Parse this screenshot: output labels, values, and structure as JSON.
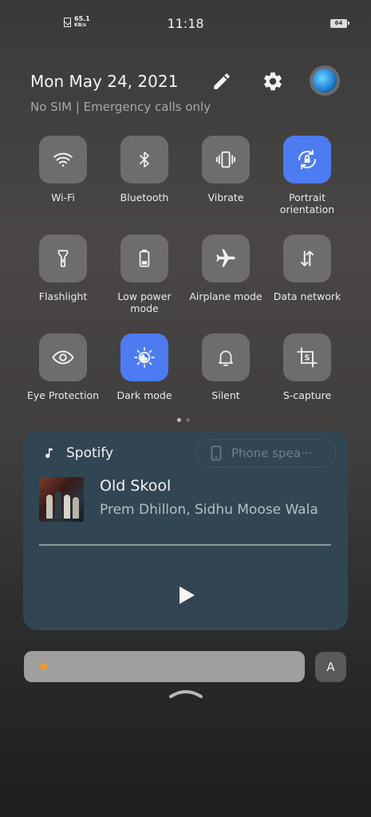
{
  "status_bar": {
    "net_speed_value": "65.1",
    "net_speed_unit": "KB/s",
    "time": "11:18",
    "battery": "64"
  },
  "header": {
    "date": "Mon May 24, 2021",
    "sim_status": "No SIM | Emergency calls only",
    "edit_icon": "pencil-icon",
    "settings_icon": "gear-icon"
  },
  "tiles": [
    {
      "label": "Wi-Fi",
      "icon": "wifi-icon",
      "active": false
    },
    {
      "label": "Bluetooth",
      "icon": "bluetooth-icon",
      "active": false
    },
    {
      "label": "Vibrate",
      "icon": "vibrate-icon",
      "active": false
    },
    {
      "label": "Portrait orientation",
      "icon": "rotation-lock-icon",
      "active": true
    },
    {
      "label": "Flashlight",
      "icon": "flashlight-icon",
      "active": false
    },
    {
      "label": "Low power mode",
      "icon": "battery-icon",
      "active": false
    },
    {
      "label": "Airplane mode",
      "icon": "airplane-icon",
      "active": false
    },
    {
      "label": "Data network",
      "icon": "data-arrows-icon",
      "active": false
    },
    {
      "label": "Eye Protection",
      "icon": "eye-icon",
      "active": false
    },
    {
      "label": "Dark mode",
      "icon": "dark-mode-icon",
      "active": true
    },
    {
      "label": "Silent",
      "icon": "bell-icon",
      "active": false
    },
    {
      "label": "S-capture",
      "icon": "screenshot-icon",
      "active": false
    }
  ],
  "media": {
    "app_name": "Spotify",
    "output_device": "Phone spea···",
    "title": "Old Skool",
    "artist": "Prem Dhillon, Sidhu Moose Wala",
    "progress": 0
  },
  "brightness": {
    "auto_label": "A"
  },
  "colors": {
    "active_tile": "#4d7cf2",
    "inactive_tile": "#6e6c6c",
    "media_card": "#324553",
    "brightness_sun": "#ef9a26"
  }
}
